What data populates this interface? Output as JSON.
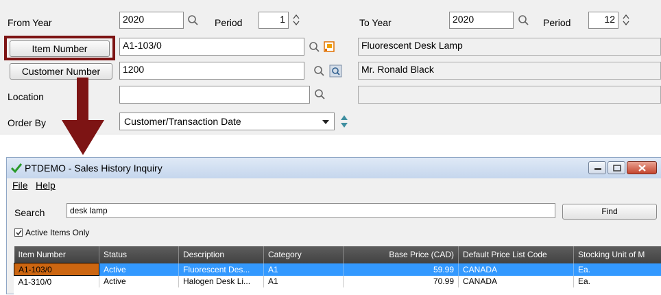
{
  "form": {
    "from_year_label": "From Year",
    "from_year": "2020",
    "period_label_1": "Period",
    "from_period": "1",
    "to_year_label": "To Year",
    "to_year": "2020",
    "period_label_2": "Period",
    "to_period": "12",
    "item_number_button": "Item Number",
    "item_number": "A1-103/0",
    "item_description": "Fluorescent Desk Lamp",
    "customer_number_button": "Customer Number",
    "customer_number": "1200",
    "customer_name": "Mr. Ronald Black",
    "location_label": "Location",
    "location_value": "",
    "location_description": "",
    "order_by_label": "Order By",
    "order_by_value": "Customer/Transaction Date"
  },
  "colors": {
    "highlight": "#7d1414",
    "selected_row": "#3399ff",
    "current_cell": "#cc6611"
  },
  "window": {
    "title": "PTDEMO - Sales History Inquiry",
    "menu": [
      "File",
      "Help"
    ],
    "search_label": "Search",
    "search_value": "desk lamp",
    "find_button": "Find",
    "active_only_label": "Active Items Only",
    "active_only_checked": true,
    "columns": [
      "Item Number",
      "Status",
      "Description",
      "Category",
      "Base Price (CAD)",
      "Default Price List Code",
      "Stocking Unit of M"
    ],
    "rows": [
      [
        "A1-103/0",
        "Active",
        "Fluorescent Des...",
        "A1",
        "59.99",
        "CANADA",
        "Ea."
      ],
      [
        "A1-310/0",
        "Active",
        "Halogen Desk Li...",
        "A1",
        "70.99",
        "CANADA",
        "Ea."
      ]
    ]
  }
}
